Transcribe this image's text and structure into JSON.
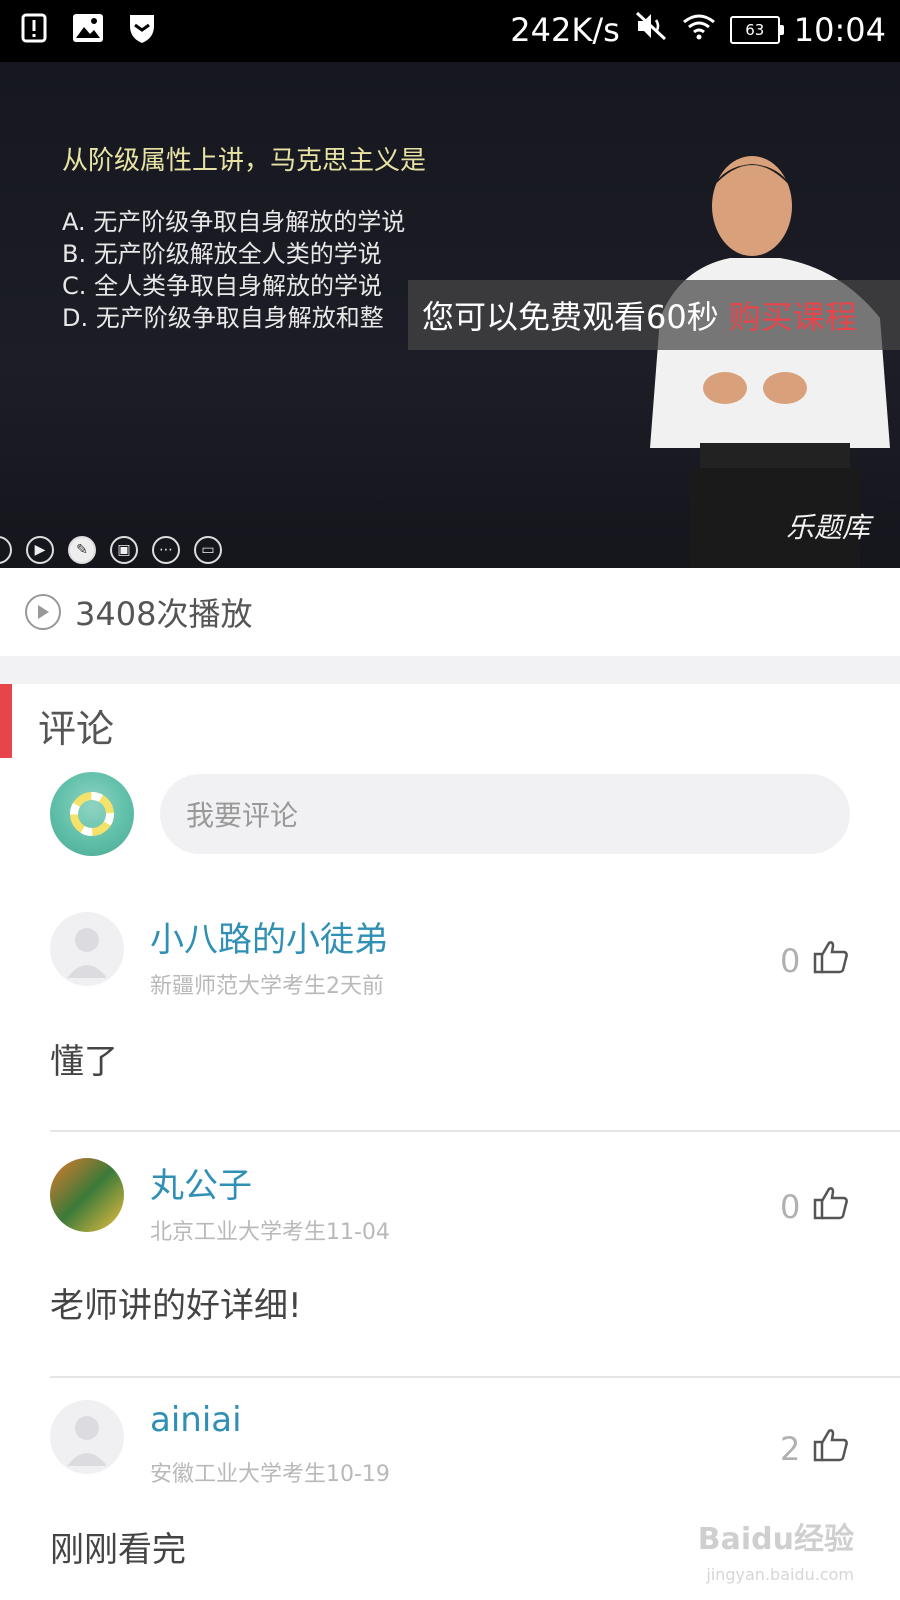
{
  "status_bar": {
    "network_speed": "242K/s",
    "battery": "63",
    "time": "10:04"
  },
  "video": {
    "slide_question": "从阶级属性上讲，马克思主义是",
    "slide_options": [
      "A.  无产阶级争取自身解放的学说",
      "B.  无产阶级解放全人类的学说",
      "C.  全人类争取自身解放的学说",
      "D.  无产阶级争取自身解放和整"
    ],
    "free_notice": "您可以免费观看60秒",
    "buy_label": "购买课程",
    "watermark": "乐题库"
  },
  "play_count": "3408次播放",
  "comments": {
    "title": "评论",
    "input_placeholder": "我要评论",
    "items": [
      {
        "user": "小八路的小徒弟",
        "meta": "新疆师范大学考生2天前",
        "likes": "0",
        "text": "懂了"
      },
      {
        "user": "丸公子",
        "meta": "北京工业大学考生11-04",
        "likes": "0",
        "text": "老师讲的好详细!"
      },
      {
        "user": "ainiai",
        "meta": "安徽工业大学考生10-19",
        "likes": "2",
        "text": "刚刚看完"
      }
    ]
  },
  "baidu_watermark": {
    "brand": "Baidu经验",
    "url": "jingyan.baidu.com"
  }
}
